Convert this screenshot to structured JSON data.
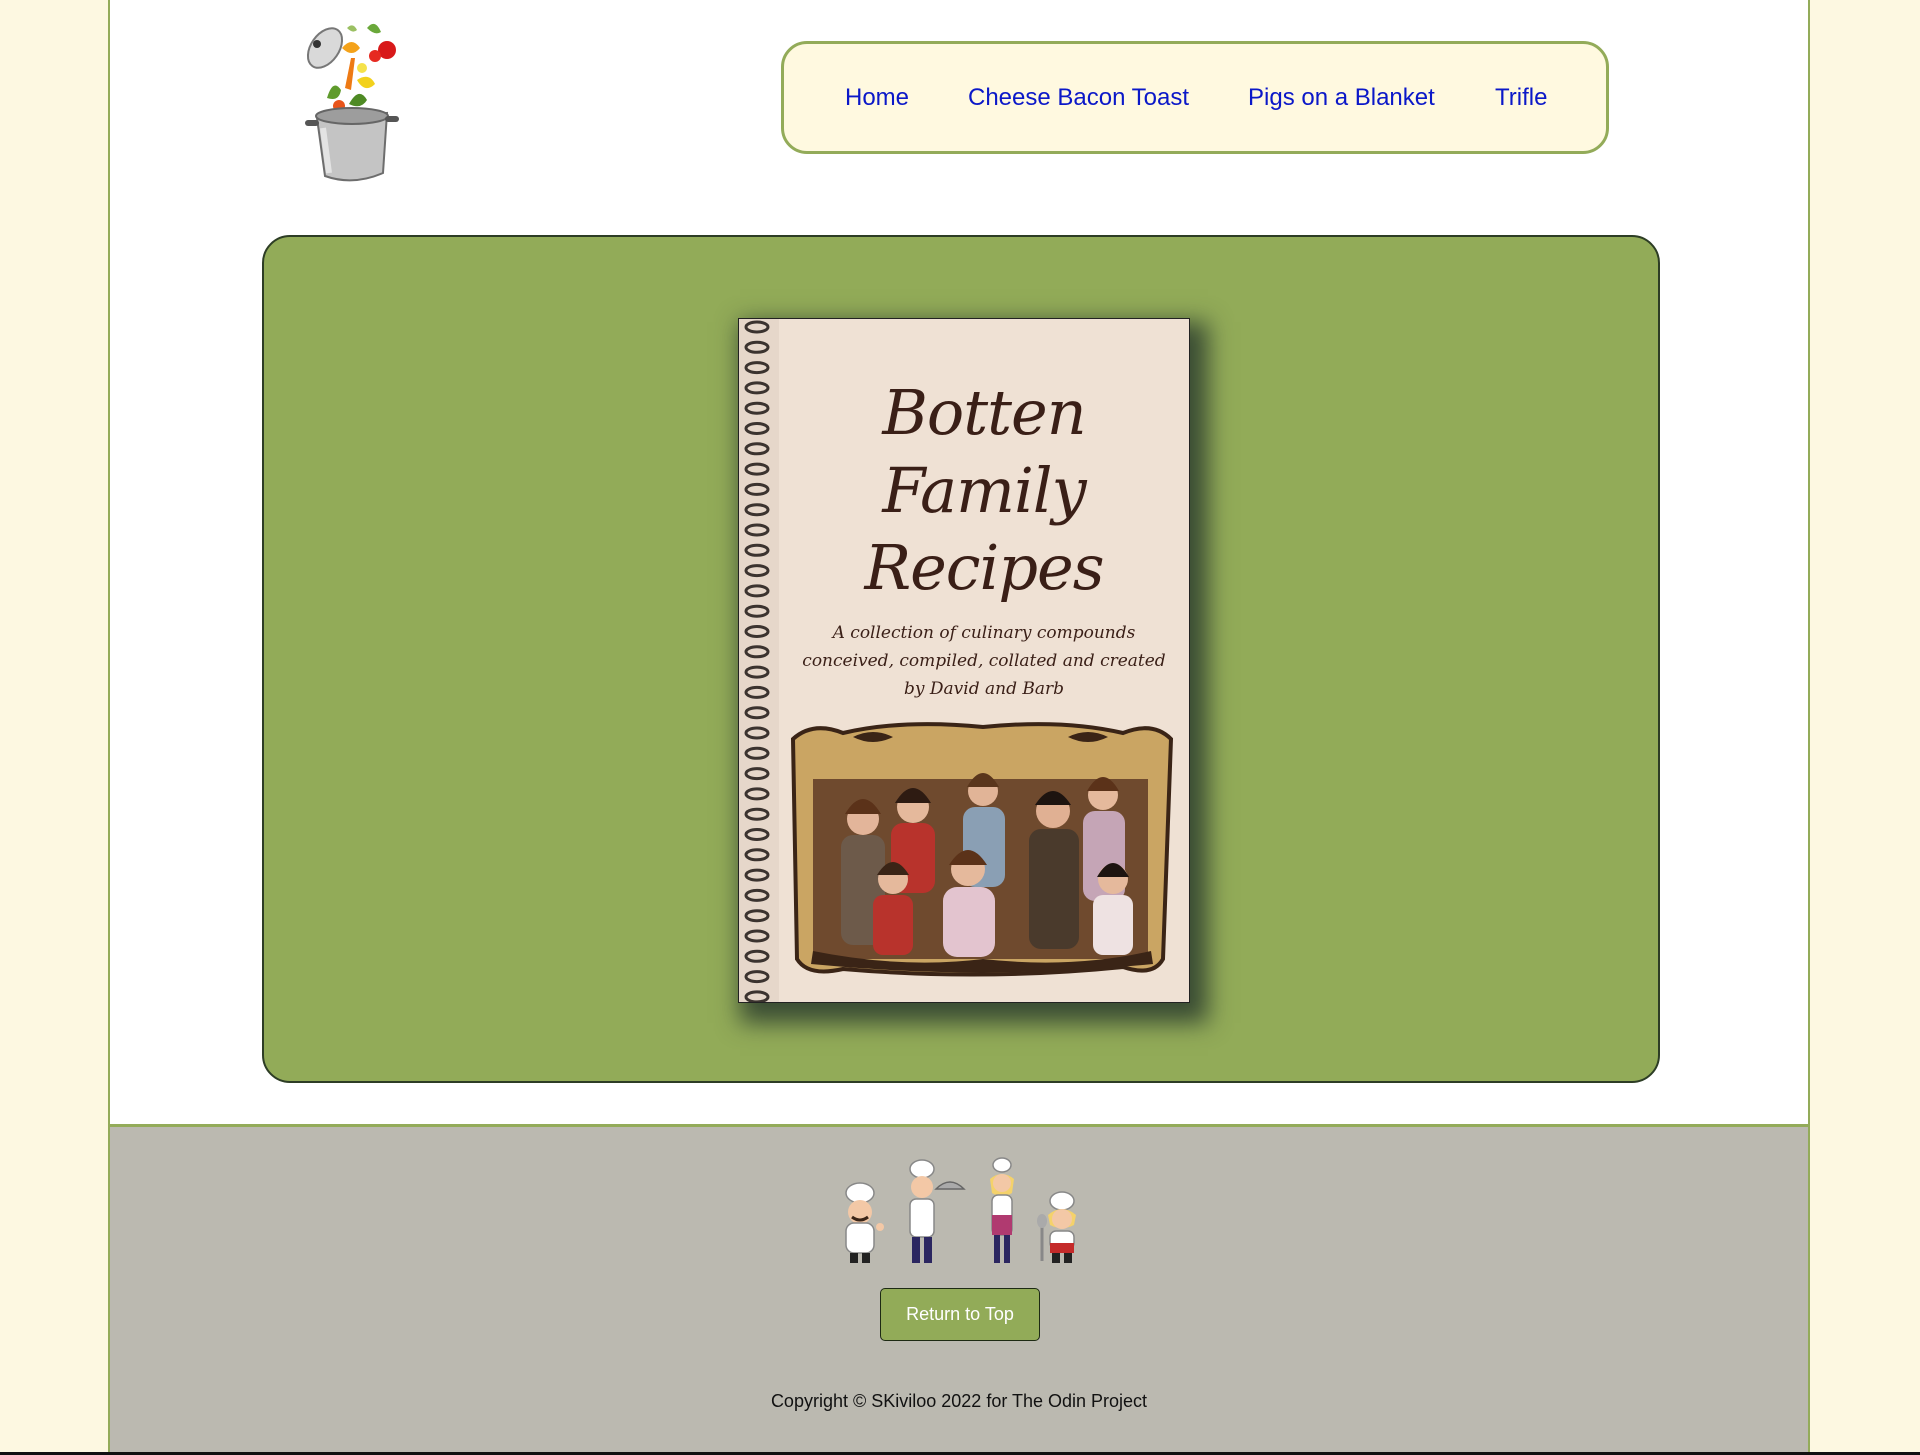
{
  "header": {
    "logo_icon": "pot-with-vegetables-icon"
  },
  "nav": {
    "items": [
      {
        "label": "Home"
      },
      {
        "label": "Cheese Bacon Toast"
      },
      {
        "label": "Pigs on a Blanket"
      },
      {
        "label": "Trifle"
      }
    ],
    "link_color": "#0b18c8",
    "background": "#fff9e0",
    "border_color": "#93ab59"
  },
  "hero": {
    "background": "#92ab58",
    "book_cover": {
      "title_line1": "Botten Family",
      "title_line2": "Recipes",
      "subtitle_line1": "A collection of culinary compounds",
      "subtitle_line2": "conceived, compiled, collated and created",
      "subtitle_line3": "by David and Barb",
      "photo_icon": "family-photo-icon"
    }
  },
  "footer": {
    "background": "#bbb9b0",
    "illustration_icon": "four-chefs-icon",
    "return_label": "Return to Top",
    "copyright": "Copyright © SKiviloo 2022 for The Odin Project"
  }
}
